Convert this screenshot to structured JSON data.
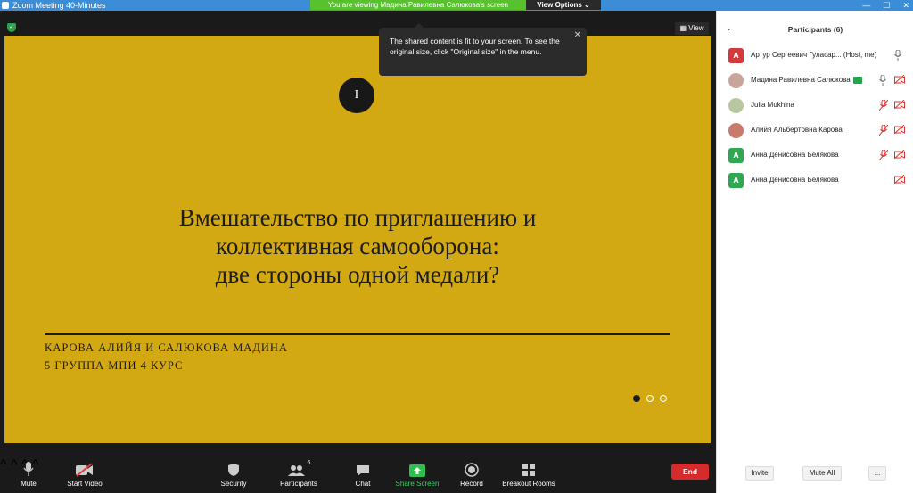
{
  "window": {
    "title": "Zoom Meeting 40-Minutes"
  },
  "banner": {
    "text": "You are viewing Мадина Равилевна Салюкова's screen",
    "view_options": "View Options"
  },
  "view_button": "View",
  "tooltip": {
    "text": "The shared content is fit to your screen. To see the original size, click \"Original size\" in the menu.",
    "close": "✕"
  },
  "slide": {
    "badge": "I",
    "title_lines": [
      "Вмешательство по приглашению и",
      "коллективная самооборона:",
      "две стороны одной медали?"
    ],
    "subtitle1": "КАРОВА АЛИЙЯ И САЛЮКОВА МАДИНА",
    "subtitle2": "5 ГРУППА МПИ 4 КУРС"
  },
  "toolbar": {
    "mute": "Mute",
    "start_video": "Start Video",
    "security": "Security",
    "participants": "Participants",
    "participants_count": "6",
    "chat": "Chat",
    "share_screen": "Share Screen",
    "record": "Record",
    "breakout": "Breakout Rooms",
    "end": "End"
  },
  "panel": {
    "title": "Participants (6)",
    "participants": [
      {
        "initial": "A",
        "name": "Артур Сергеевич Гуласар... (Host, me)",
        "color": "#d43a3a"
      },
      {
        "initial": "",
        "name": "Мадина Равилевна Салюкова",
        "color": "#c9a49a"
      },
      {
        "initial": "",
        "name": "Julia Mukhina",
        "color": "#b8c7a0"
      },
      {
        "initial": "",
        "name": "Алийя Альбертовна Карова",
        "color": "#c97a6a"
      },
      {
        "initial": "A",
        "name": "Анна Денисовна Белякова",
        "color": "#2fa84f"
      },
      {
        "initial": "A",
        "name": "Анна Денисовна Белякова",
        "color": "#2fa84f"
      }
    ],
    "invite": "Invite",
    "mute_all": "Mute All",
    "more": "..."
  }
}
